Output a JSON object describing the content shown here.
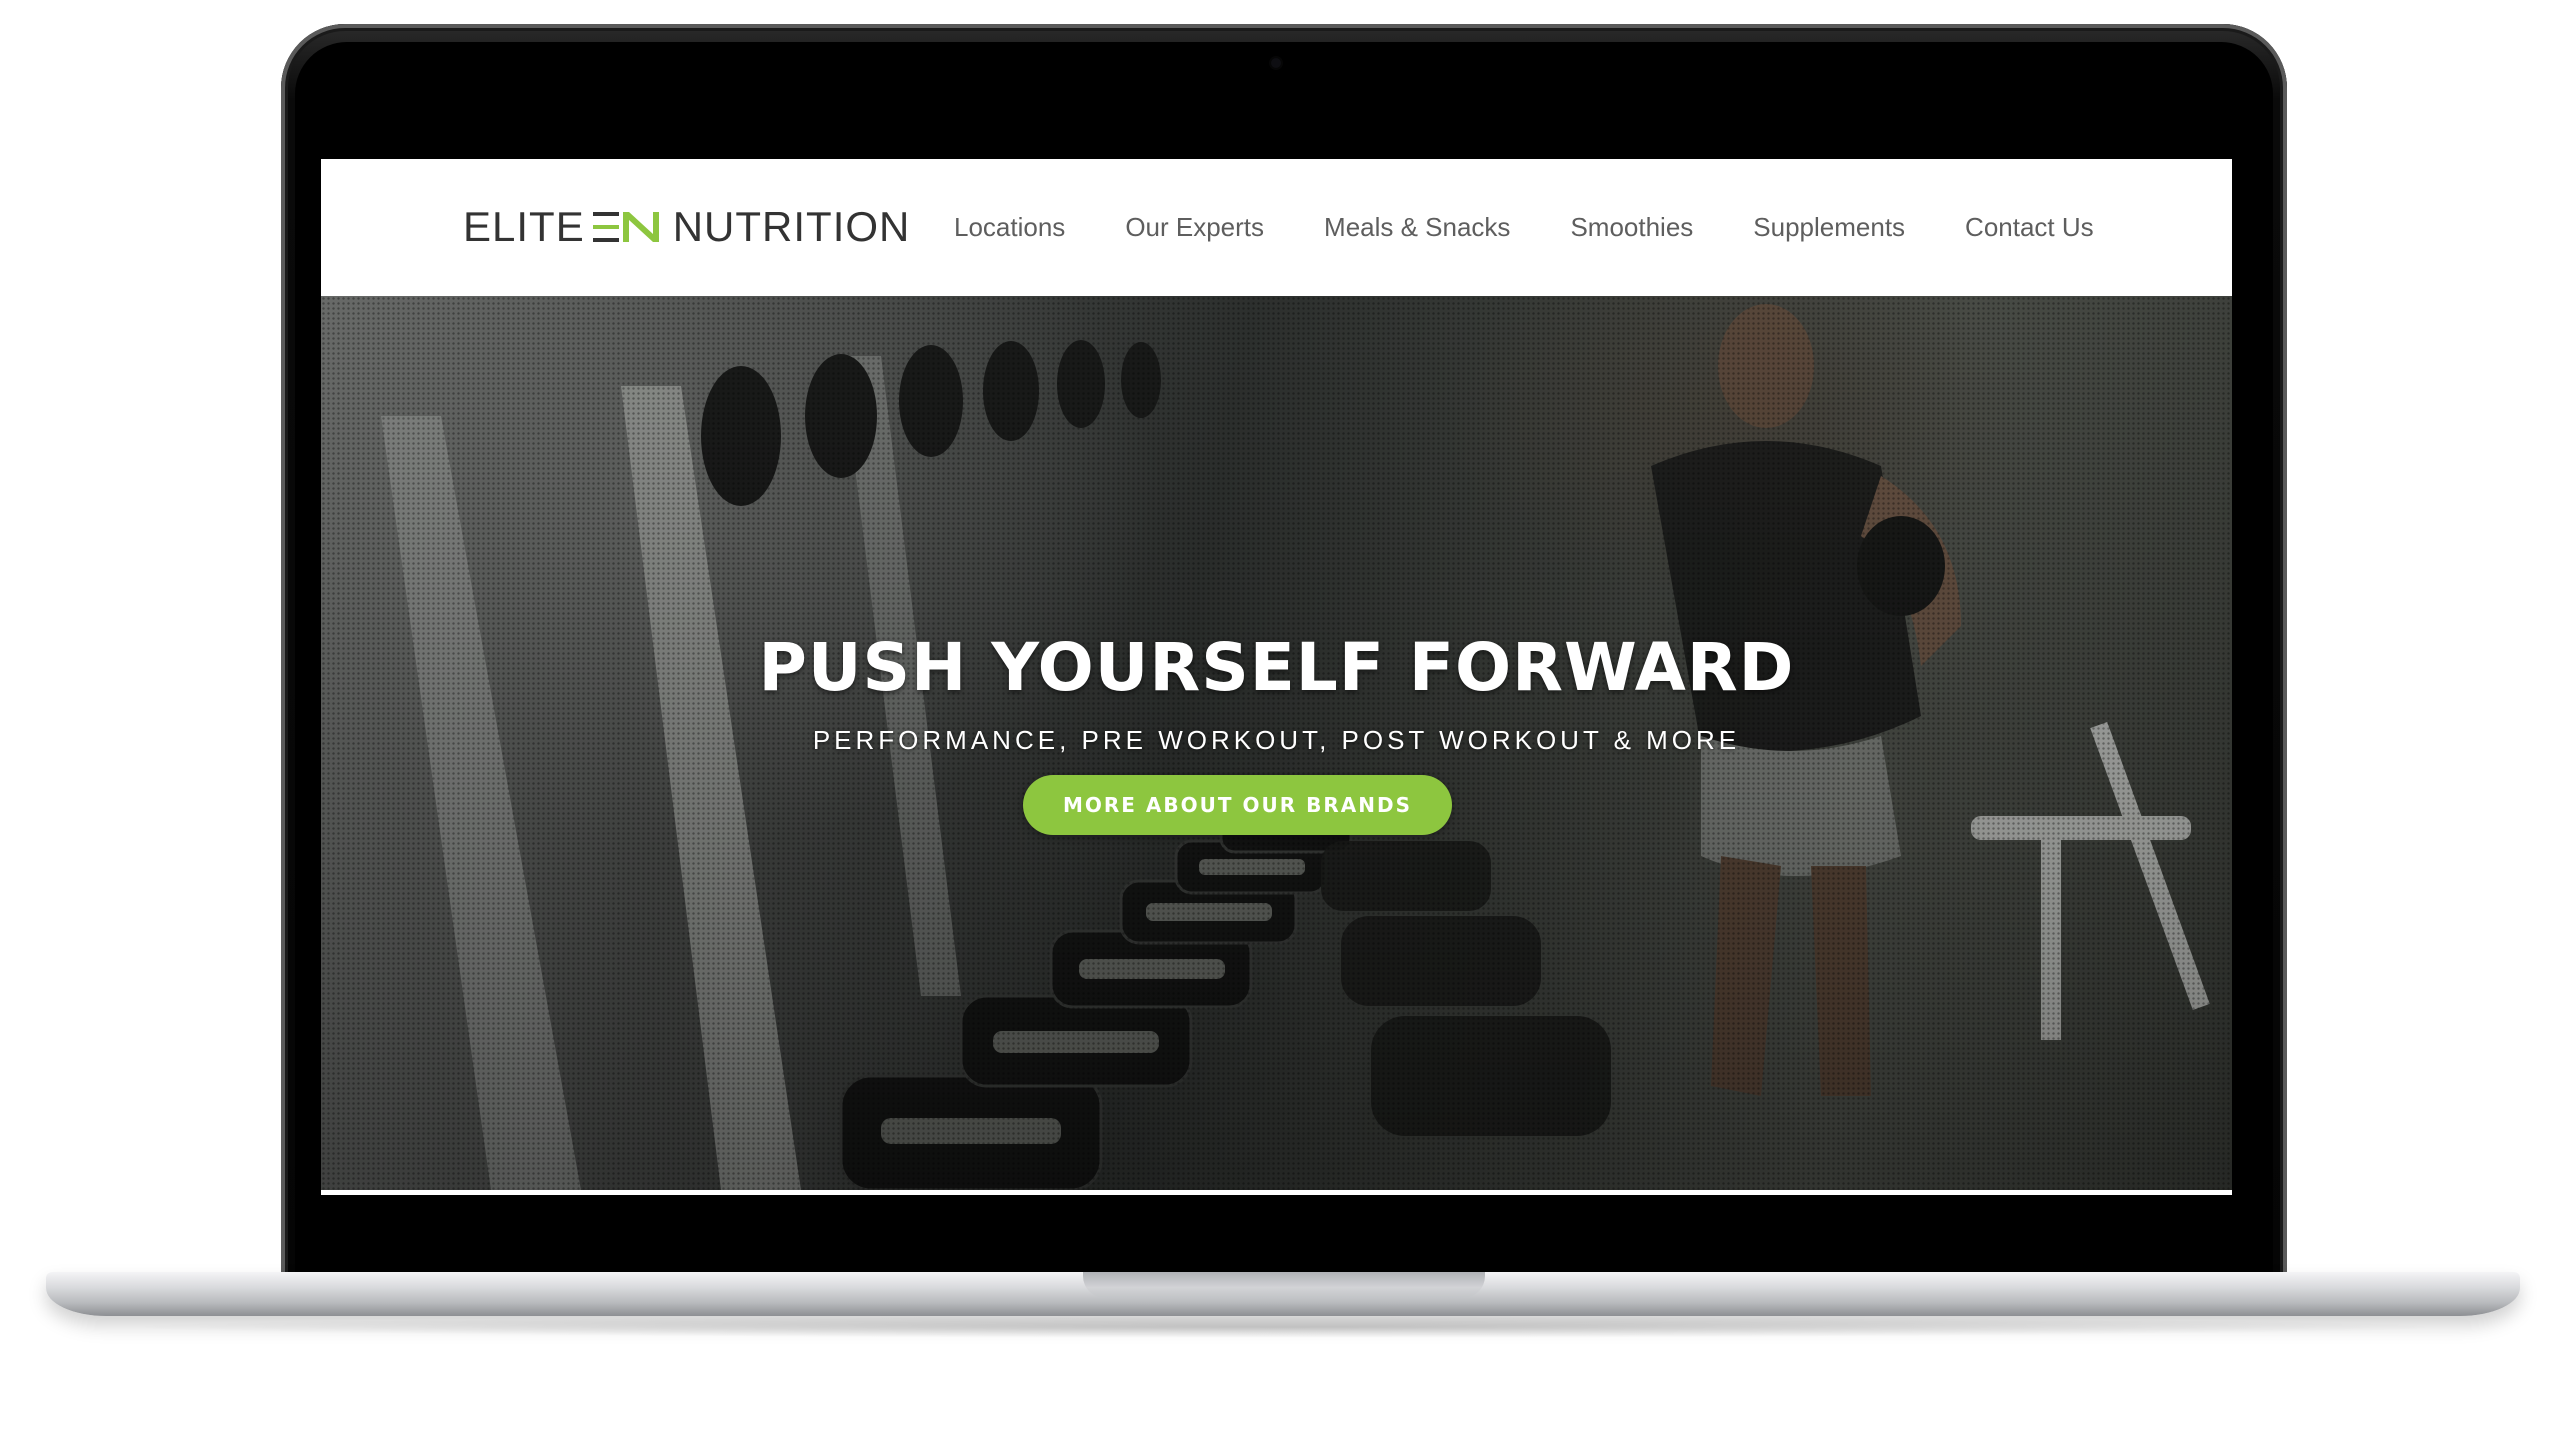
{
  "site": {
    "logo": {
      "word_left": "ELITE",
      "word_right": "NUTRITION",
      "mark_icon": "elite-n-mark-icon",
      "accent": "#8dc63f"
    },
    "nav": {
      "items": [
        {
          "label": "Locations"
        },
        {
          "label": "Our Experts"
        },
        {
          "label": "Meals & Snacks"
        },
        {
          "label": "Smoothies"
        },
        {
          "label": "Supplements"
        },
        {
          "label": "Contact Us"
        }
      ]
    }
  },
  "hero": {
    "title": "PUSH YOURSELF FORWARD",
    "subtitle": "PERFORMANCE, PRE WORKOUT, POST WORKOUT & MORE",
    "cta_label": "MORE ABOUT OUR BRANDS",
    "cta_color": "#8dc63f",
    "background": "gym dumbbell rack photo"
  },
  "device": {
    "type": "laptop",
    "bezel_color": "#000000",
    "body_color": "#c9cacd"
  }
}
